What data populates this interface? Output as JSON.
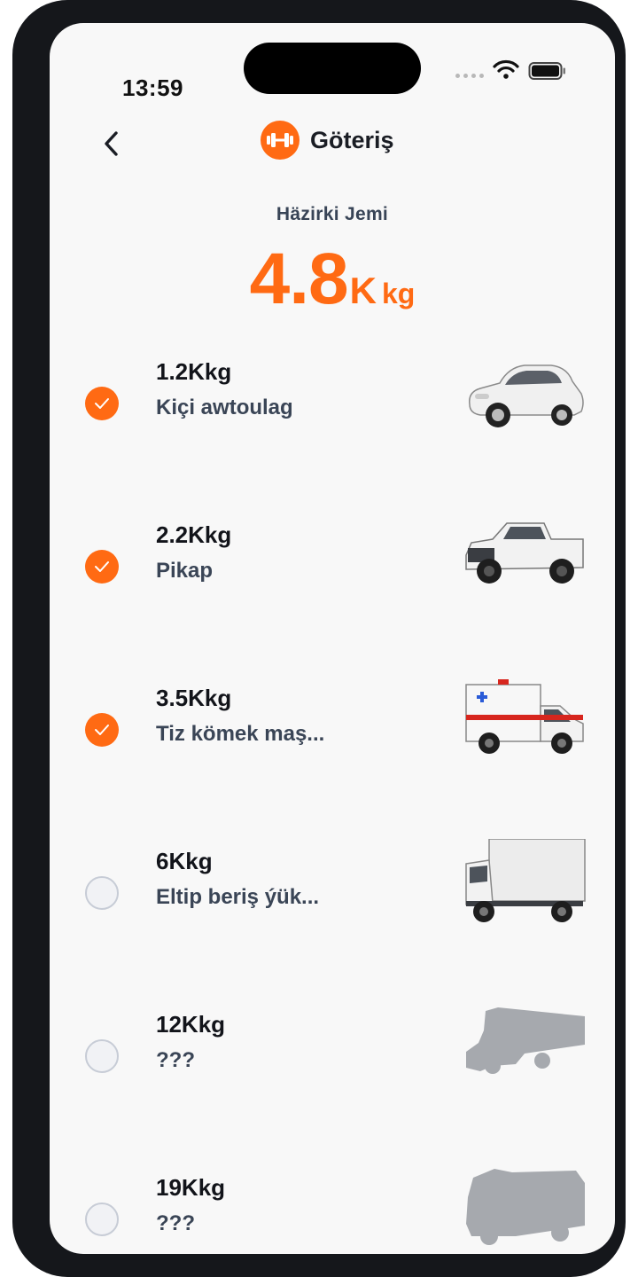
{
  "status_bar": {
    "time": "13:59"
  },
  "header": {
    "title": "Göteriş",
    "back_icon": "chevron-left-icon",
    "badge_icon": "dumbbell-icon"
  },
  "current_load": {
    "label": "Häzirki Jemi",
    "value": "4.8",
    "unit_k": "K",
    "unit_kg": "kg"
  },
  "colors": {
    "accent": "#ff6a13",
    "text_dark": "#12141a",
    "text_muted": "#3a4556",
    "locked_gray": "#a6a9ae"
  },
  "tiers": [
    {
      "weight": "1.2Kkg",
      "name": "Kiçi awtoulag",
      "checked": true,
      "vehicle_icon": "small-car-icon"
    },
    {
      "weight": "2.2Kkg",
      "name": "Pikap",
      "checked": true,
      "vehicle_icon": "pickup-truck-icon"
    },
    {
      "weight": "3.5Kkg",
      "name": "Tiz kömek maş...",
      "checked": true,
      "vehicle_icon": "ambulance-icon"
    },
    {
      "weight": "6Kkg",
      "name": "Eltip beriş ýük...",
      "checked": false,
      "vehicle_icon": "box-truck-icon"
    },
    {
      "weight": "12Kkg",
      "name": "???",
      "checked": false,
      "vehicle_icon": "locked-truck-silhouette-icon"
    },
    {
      "weight": "19Kkg",
      "name": "???",
      "checked": false,
      "vehicle_icon": "locked-heavy-truck-silhouette-icon"
    }
  ]
}
